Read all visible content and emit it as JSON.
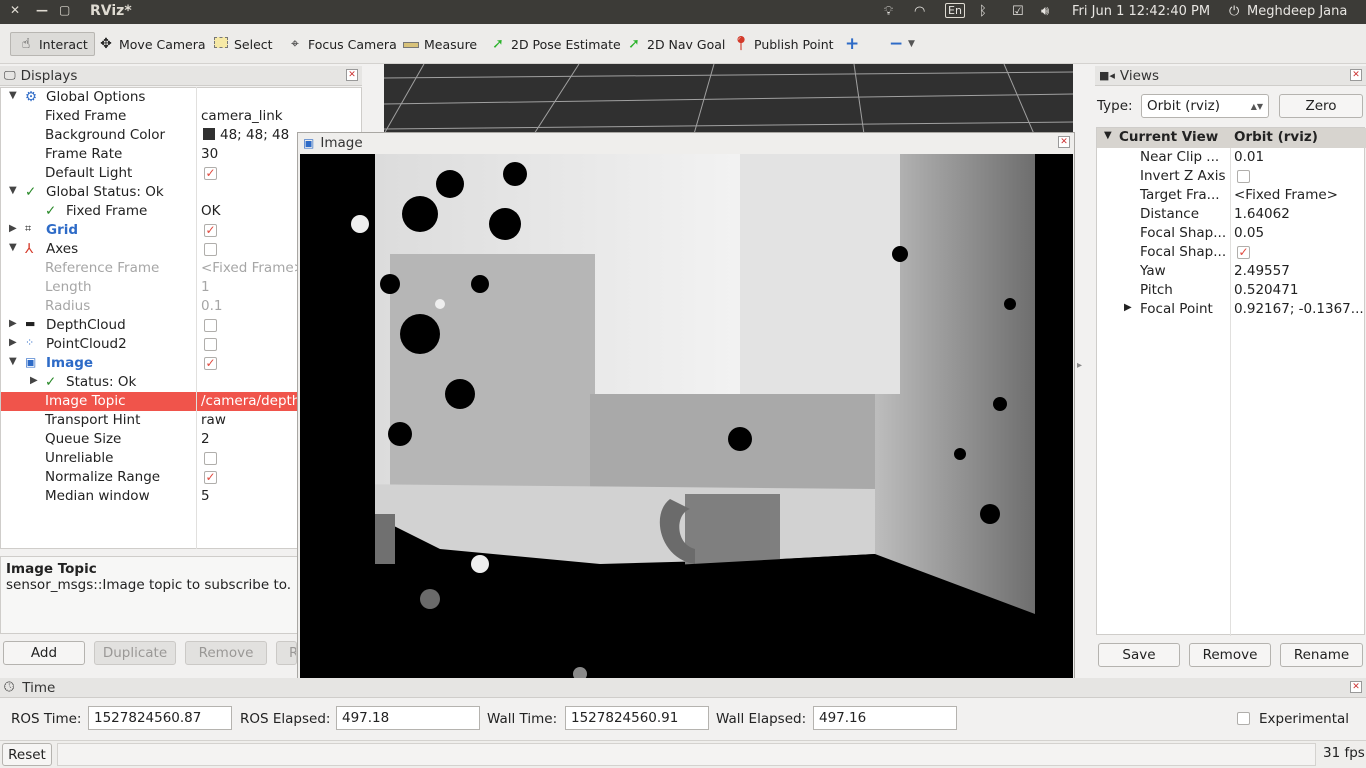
{
  "top_bar": {
    "window_title": "RViz*",
    "date_time": "Fri Jun  1 12:42:40 PM",
    "user": "Meghdeep Jana",
    "keyboard": "En"
  },
  "toolbar": {
    "tools": [
      {
        "label": "Interact",
        "icon": "hand-icon"
      },
      {
        "label": "Move Camera",
        "icon": "move-camera-icon"
      },
      {
        "label": "Select",
        "icon": "select-icon"
      },
      {
        "label": "Focus Camera",
        "icon": "focus-camera-icon"
      },
      {
        "label": "Measure",
        "icon": "ruler-icon"
      },
      {
        "label": "2D Pose Estimate",
        "icon": "pose-arrow-icon"
      },
      {
        "label": "2D Nav Goal",
        "icon": "nav-arrow-icon"
      },
      {
        "label": "Publish Point",
        "icon": "map-pin-icon"
      }
    ]
  },
  "displays": {
    "title": "Displays",
    "rows": [
      {
        "key": "Global Options",
        "value": ""
      },
      {
        "key": "Fixed Frame",
        "value": "camera_link"
      },
      {
        "key": "Background Color",
        "value": "48; 48; 48"
      },
      {
        "key": "Frame Rate",
        "value": "30"
      },
      {
        "key": "Default Light",
        "value": ""
      },
      {
        "key": "Global Status: Ok",
        "value": ""
      },
      {
        "key": "Fixed Frame",
        "value": "OK"
      },
      {
        "key": "Grid",
        "value": ""
      },
      {
        "key": "Axes",
        "value": ""
      },
      {
        "key": "Reference Frame",
        "value": "<Fixed Frame>"
      },
      {
        "key": "Length",
        "value": "1"
      },
      {
        "key": "Radius",
        "value": "0.1"
      },
      {
        "key": "DepthCloud",
        "value": ""
      },
      {
        "key": "PointCloud2",
        "value": ""
      },
      {
        "key": "Image",
        "value": ""
      },
      {
        "key": "Status: Ok",
        "value": ""
      },
      {
        "key": "Image Topic",
        "value": "/camera/depth"
      },
      {
        "key": "Transport Hint",
        "value": "raw"
      },
      {
        "key": "Queue Size",
        "value": "2"
      },
      {
        "key": "Unreliable",
        "value": ""
      },
      {
        "key": "Normalize Range",
        "value": ""
      },
      {
        "key": "Median window",
        "value": "5"
      }
    ],
    "description_title": "Image Topic",
    "description_text": "sensor_msgs::Image topic to subscribe to.",
    "buttons": {
      "add": "Add",
      "duplicate": "Duplicate",
      "remove": "Remove",
      "rename": "R"
    }
  },
  "image_window": {
    "title": "Image"
  },
  "views": {
    "title": "Views",
    "type_label": "Type:",
    "type_value": "Orbit (rviz)",
    "zero_button": "Zero",
    "header": {
      "key": "Current View",
      "value": "Orbit (rviz)"
    },
    "rows": [
      {
        "key": "Near Clip ...",
        "value": "0.01"
      },
      {
        "key": "Invert Z Axis",
        "value": ""
      },
      {
        "key": "Target Fra...",
        "value": "<Fixed Frame>"
      },
      {
        "key": "Distance",
        "value": "1.64062"
      },
      {
        "key": "Focal Shap...",
        "value": "0.05"
      },
      {
        "key": "Focal Shap...",
        "value": ""
      },
      {
        "key": "Yaw",
        "value": "2.49557"
      },
      {
        "key": "Pitch",
        "value": "0.520471"
      },
      {
        "key": "Focal Point",
        "value": "0.92167; -0.1367..."
      }
    ],
    "buttons": {
      "save": "Save",
      "remove": "Remove",
      "rename": "Rename"
    }
  },
  "time": {
    "title": "Time",
    "ros_time_label": "ROS Time:",
    "ros_time": "1527824560.87",
    "ros_elapsed_label": "ROS Elapsed:",
    "ros_elapsed": "497.18",
    "wall_time_label": "Wall Time:",
    "wall_time": "1527824560.91",
    "wall_elapsed_label": "Wall Elapsed:",
    "wall_elapsed": "497.16",
    "experimental_label": "Experimental"
  },
  "status": {
    "reset": "Reset",
    "fps": "31 fps"
  }
}
